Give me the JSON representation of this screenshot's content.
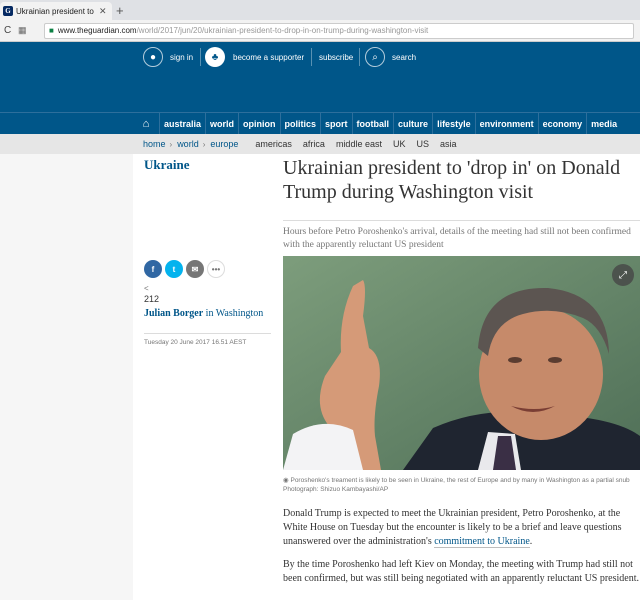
{
  "browser": {
    "tab_title": "Ukrainian president to 'dr…",
    "tab_close": "✕",
    "new_tab": "+",
    "url_host": "www.theguardian.com",
    "url_path": "/world/2017/jun/20/ukrainian-president-to-drop-in-on-trump-during-washington-visit"
  },
  "header": {
    "sign_in": "sign in",
    "become_supporter": "become a supporter",
    "subscribe": "subscribe",
    "search": "search"
  },
  "nav": {
    "items": [
      "australia",
      "world",
      "opinion",
      "politics",
      "sport",
      "football",
      "culture",
      "lifestyle",
      "environment",
      "economy",
      "media"
    ]
  },
  "subnav": {
    "breadcrumbs": [
      "home",
      "world",
      "europe"
    ],
    "items": [
      "americas",
      "africa",
      "middle east",
      "UK",
      "US",
      "asia"
    ]
  },
  "article": {
    "section": "Ukraine",
    "headline": "Ukrainian president to 'drop in' on Donald Trump during Washington visit",
    "standfirst": "Hours before Petro Poroshenko's arrival, details of the meeting had still not been confirmed with the apparently reluctant US president",
    "share_count": "212",
    "author": "Julian Borger",
    "author_location": "in Washington",
    "date": "Tuesday 20 June 2017 16.51 AEST",
    "caption": "Poroshenko's treament is likely to be seen in Ukraine, the rest of Europe and by many in Washington as a partial snub Photograph: Shizuo Kambayashi/AP",
    "body1_pre": "Donald Trump is expected to meet the Ukrainian president, Petro Poroshenko, at the White House on Tuesday but the encounter is likely to be a brief and leave questions unanswered over the administration's ",
    "body1_link": "commitment to Ukraine",
    "body1_post": ".",
    "body2": "By the time Poroshenko had left Kiev on Monday, the meeting with Trump had still not been confirmed, but was still being negotiated with an apparently reluctant US president."
  },
  "colors": {
    "brand_blue": "#005689",
    "facebook": "#3067a3",
    "twitter": "#03b3ee",
    "email": "#767676"
  }
}
